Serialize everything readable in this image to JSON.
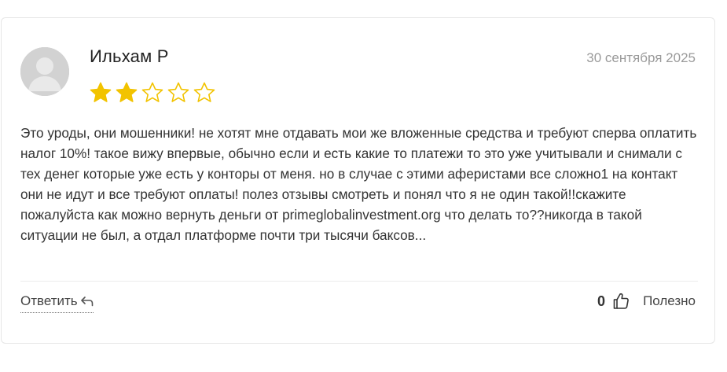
{
  "review": {
    "author": "Ильхам Р",
    "date": "30 сентября 2025",
    "rating": 2,
    "rating_max": 5,
    "star_color": "#f2c300",
    "text": "Это уроды, они мошенники! не хотят мне отдавать мои же вложенные средства и требуют сперва оплатить налог 10%! такое вижу впервые, обычно если и есть какие то платежи то это уже учитывали и снимали с тех денег которые уже есть у конторы от меня. но в случае с этими аферистами все сложно1 на контакт они не идут и все требуют оплаты! полез отзывы смотреть и понял что я не один такой!!скажите пожалуйста как можно вернуть деньги от primeglobalinvestment.org что делать то??никогда в такой ситуации не был, а отдал платформе почти три тысячи баксов..."
  },
  "actions": {
    "reply_label": "Ответить",
    "helpful_count": "0",
    "helpful_label": "Полезно",
    "reply_icon": "reply-arrow-icon",
    "helpful_icon": "thumbs-up-icon"
  }
}
